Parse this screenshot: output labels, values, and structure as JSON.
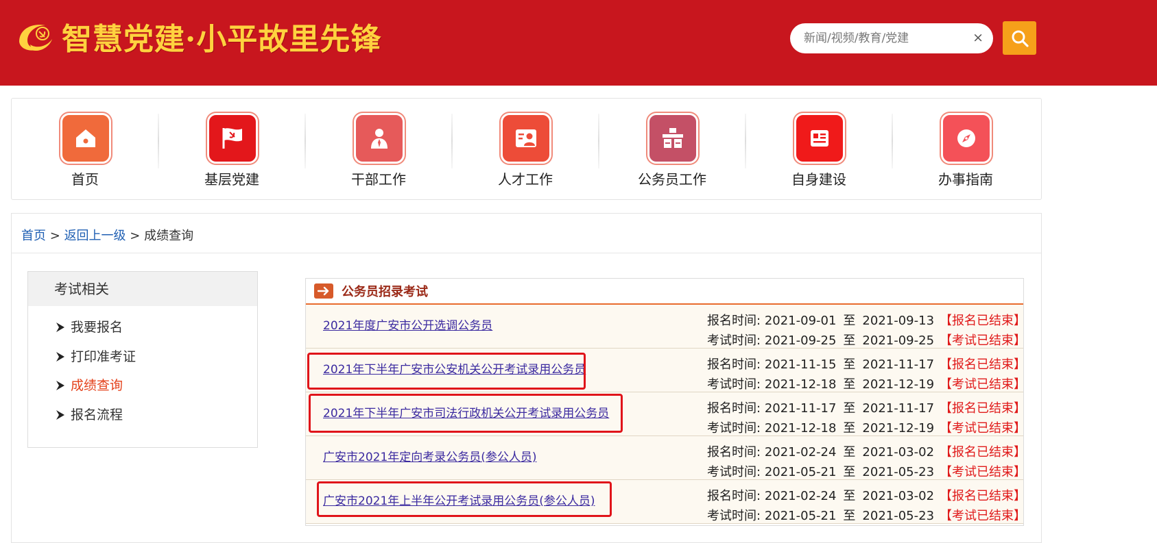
{
  "header": {
    "logo_text": "智慧党建·小平故里先锋",
    "search_placeholder": "新闻/视频/教育/党建",
    "clear_symbol": "×",
    "brand_color": "#c8161e",
    "accent_color": "#f6a01a"
  },
  "nav": {
    "items": [
      {
        "label": "首页",
        "icon": "home-icon",
        "color": "#f06a3b"
      },
      {
        "label": "基层党建",
        "icon": "party-flag-icon",
        "color": "#e3171b"
      },
      {
        "label": "干部工作",
        "icon": "person-tie-icon",
        "color": "#e65a5a"
      },
      {
        "label": "人才工作",
        "icon": "id-card-person-icon",
        "color": "#ed4c38"
      },
      {
        "label": "公务员工作",
        "icon": "desk-icon",
        "color": "#c45066"
      },
      {
        "label": "自身建设",
        "icon": "document-icon",
        "color": "#f01a1a"
      },
      {
        "label": "办事指南",
        "icon": "compass-icon",
        "color": "#f45158"
      }
    ]
  },
  "breadcrumb": {
    "home": "首页",
    "separator": ">",
    "back": "返回上一级",
    "current": "成绩查询"
  },
  "sidebar": {
    "title": "考试相关",
    "items": [
      {
        "label": "我要报名",
        "active": false
      },
      {
        "label": "打印准考证",
        "active": false
      },
      {
        "label": "成绩查询",
        "active": true
      },
      {
        "label": "报名流程",
        "active": false
      }
    ]
  },
  "exam": {
    "title": "公务员招录考试",
    "reg_label": "报名时间:",
    "exam_label": "考试时间:",
    "to": "至",
    "rows": [
      {
        "title": "2021年度广安市公开选调公务员",
        "reg_start": "2021-09-01",
        "reg_end": "2021-09-13",
        "exam_start": "2021-09-25",
        "exam_end": "2021-09-25",
        "reg_status": "【报名已结束】",
        "exam_status": "【考试已结束】",
        "highlighted": false
      },
      {
        "title": "2021年下半年广安市公安机关公开考试录用公务员",
        "reg_start": "2021-11-15",
        "reg_end": "2021-11-17",
        "exam_start": "2021-12-18",
        "exam_end": "2021-12-19",
        "reg_status": "【报名已结束】",
        "exam_status": "【考试已结束】",
        "highlighted": true
      },
      {
        "title": "2021年下半年广安市司法行政机关公开考试录用公务员",
        "reg_start": "2021-11-17",
        "reg_end": "2021-11-17",
        "exam_start": "2021-12-18",
        "exam_end": "2021-12-19",
        "reg_status": "【报名已结束】",
        "exam_status": "【考试已结束】",
        "highlighted": true
      },
      {
        "title": "广安市2021年定向考录公务员(参公人员)",
        "reg_start": "2021-02-24",
        "reg_end": "2021-03-02",
        "exam_start": "2021-05-21",
        "exam_end": "2021-05-23",
        "reg_status": "【报名已结束】",
        "exam_status": "【考试已结束】",
        "highlighted": false
      },
      {
        "title": "广安市2021年上半年公开考试录用公务员(参公人员)",
        "reg_start": "2021-02-24",
        "reg_end": "2021-03-02",
        "exam_start": "2021-05-21",
        "exam_end": "2021-05-23",
        "reg_status": "【报名已结束】",
        "exam_status": "【考试已结束】",
        "highlighted": true
      }
    ]
  }
}
